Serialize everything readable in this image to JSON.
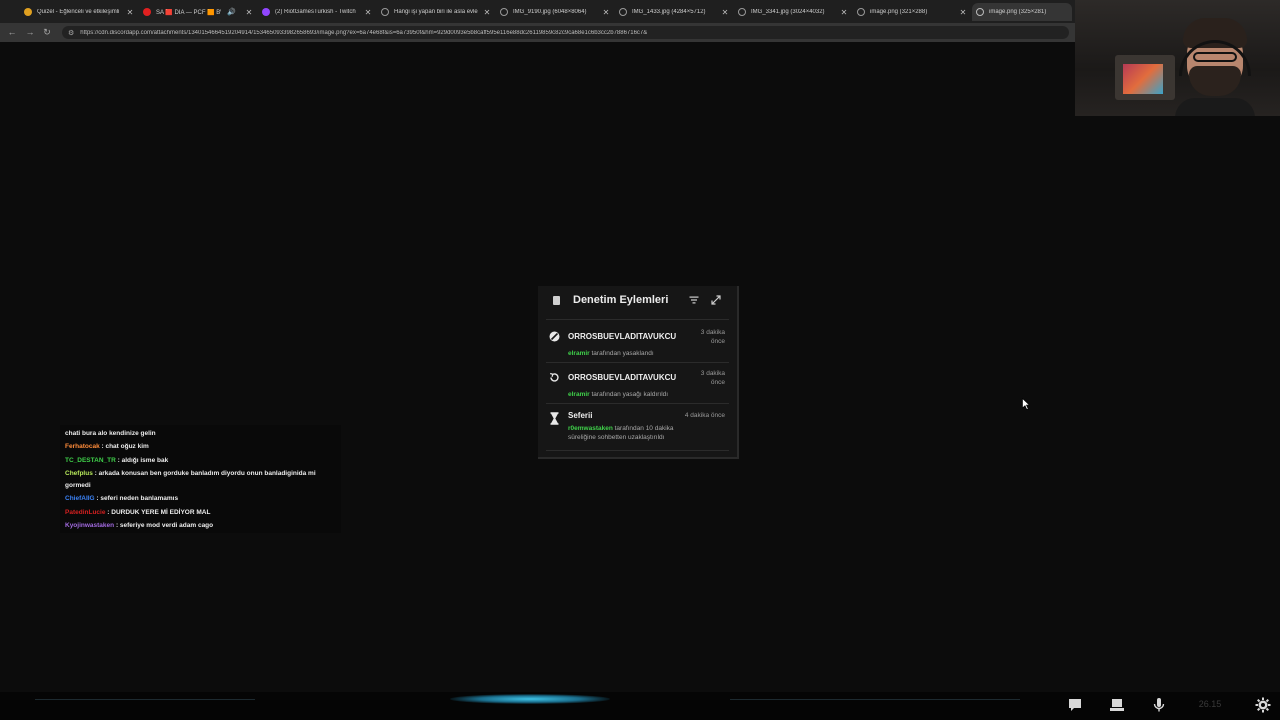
{
  "browser": {
    "tabs": [
      {
        "title": "Quizel - Eğlenceli ve etkileşimli",
        "favicon": "quizel-icon",
        "favicon_color": "#e0a020"
      },
      {
        "title": "SA 🟥 DIA — PCF 🟧 BW",
        "favicon": "twitch-live-icon",
        "favicon_color": "#e02020"
      },
      {
        "title": "(2) RiotGamesTurkish - Twitch",
        "favicon": "twitch-icon",
        "favicon_color": "#9146ff"
      },
      {
        "title": "Hangi işi yapan biri ile asla evle",
        "favicon": "globe-icon",
        "favicon_color": "#999999"
      },
      {
        "title": "IMG_9190.jpg (6048×8064)",
        "favicon": "globe-icon",
        "favicon_color": "#999999"
      },
      {
        "title": "IMG_1433.jpg (4284×5712)",
        "favicon": "globe-icon",
        "favicon_color": "#999999"
      },
      {
        "title": "IMG_3341.jpg (3024×4032)",
        "favicon": "globe-icon",
        "favicon_color": "#999999"
      },
      {
        "title": "image.png (321×288)",
        "favicon": "globe-icon",
        "favicon_color": "#999999"
      },
      {
        "title": "image.png (325×281)",
        "favicon": "globe-icon",
        "favicon_color": "#999999"
      }
    ],
    "active_tab_index": 8,
    "url": "https://cdn.discordapp.com/attachments/1340154664519204914/1534650933982658693/image.png?ex=6a74e68f&is=6a73950f&hm=929d0093e5b8caff595e116e88dc26119859c82c9ca68e1c6b3cc2b7886716c7&"
  },
  "audit_log": {
    "title": "Denetim Eylemleri",
    "entries": [
      {
        "icon": "ban-icon",
        "target": "ORROSBUEVLADITAVUKCU",
        "time_line1": "3 dakika",
        "time_line2": "önce",
        "actor": "elramir",
        "action": " tarafından yasaklandı"
      },
      {
        "icon": "unban-icon",
        "target": "ORROSBUEVLADITAVUKCU",
        "time_line1": "3 dakika",
        "time_line2": "önce",
        "actor": "elramir",
        "action": " tarafından yasağı kaldırıldı"
      },
      {
        "icon": "timeout-icon",
        "target": "Seferii",
        "time_line1": "4 dakika önce",
        "time_line2": "",
        "actor": "r0emwastaken",
        "action": " tarafından 10 dakika süreliğine sohbetten uzaklaştırıldı"
      }
    ]
  },
  "chat": {
    "messages": [
      {
        "user": "",
        "user_color": "#ededed",
        "text": "chati bura alo kendinize gelin"
      },
      {
        "user": "Ferhatocak",
        "user_color": "#ff8c3a",
        "text": " : chat oğuz kim"
      },
      {
        "user": "TC_DESTAN_TR",
        "user_color": "#3fd14a",
        "text": " : aldığı isme bak"
      },
      {
        "user": "Chefplus",
        "user_color": "#b6e85a",
        "text": " : arkada konusan ben gorduke banladım diyordu onun banladiginida mi gormedi"
      },
      {
        "user": "ChiefAIIG",
        "user_color": "#3b82f6",
        "text": " : seferi neden banlamamıs"
      },
      {
        "user": "PatedinLucie",
        "user_color": "#d42020",
        "text": " : DURDUK YERE Mİ EDİYOR MAL"
      },
      {
        "user": "Kyojinwastaken",
        "user_color": "#a26ae0",
        "text": " : seferiye mod verdi adam cago"
      }
    ]
  },
  "taskbar": {
    "clock": "26.15",
    "icons": [
      "chat-icon",
      "stack-icon",
      "microphone-icon",
      "settings-icon"
    ]
  },
  "colors": {
    "actor_green": "#3fd14a",
    "card_bg": "#161616",
    "page_bg": "#0c0c0c"
  }
}
